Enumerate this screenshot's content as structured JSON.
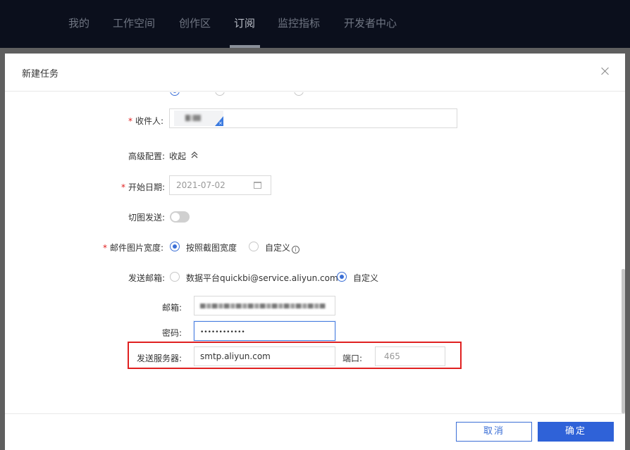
{
  "nav": {
    "items": [
      "我的",
      "工作空间",
      "创作区",
      "订阅",
      "监控指标",
      "开发者中心"
    ],
    "active_index": 3
  },
  "modal": {
    "title": "新建任务",
    "form": {
      "recipient": {
        "label": "收件人:",
        "tag_text": ""
      },
      "advanced": {
        "label": "高级配置:",
        "value": "收起"
      },
      "start_date": {
        "label": "开始日期:",
        "value": "2021-07-02"
      },
      "slice_send": {
        "label": "切图发送:"
      },
      "image_width": {
        "label": "邮件图片宽度:",
        "options": [
          "按照截图宽度",
          "自定义"
        ],
        "selected_index": 0
      },
      "send_mail": {
        "label": "发送邮箱:",
        "options": [
          "数据平台quickbi@service.aliyun.com",
          "自定义"
        ],
        "selected_index": 1
      },
      "email": {
        "label": "邮箱:",
        "value": ""
      },
      "password": {
        "label": "密码:",
        "value": "••••••••••••"
      },
      "smtp_server": {
        "label": "发送服务器:",
        "value": "smtp.aliyun.com"
      },
      "port": {
        "label": "端口:",
        "value": "465"
      }
    },
    "footer": {
      "cancel_label": "取消",
      "ok_label": "确定"
    }
  },
  "colors": {
    "primary": "#2f62d8",
    "required": "#e02020",
    "highlight": "#e02020"
  }
}
